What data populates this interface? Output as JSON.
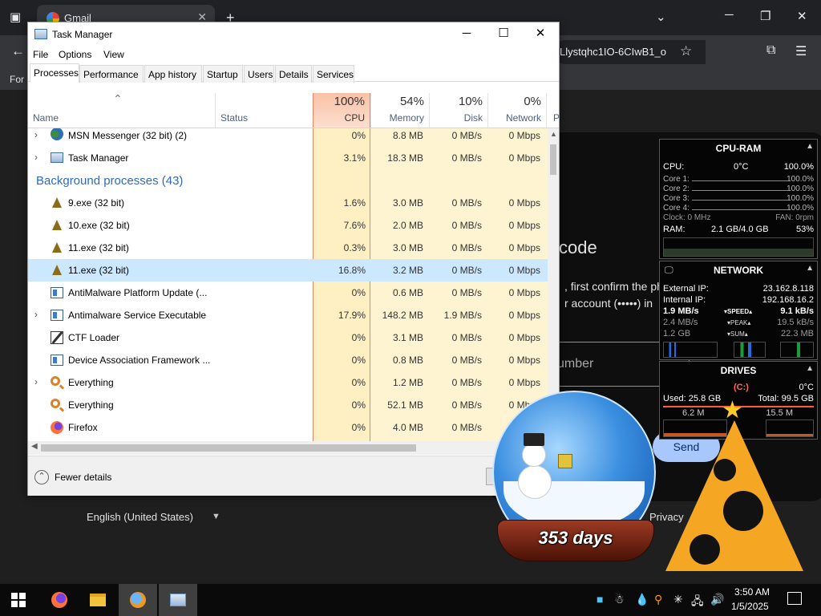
{
  "browser": {
    "tab_title": "Gmail",
    "omnibox_text": "Llystqhc1IO-6CIwB1_o",
    "bookmark_text": "For",
    "page": {
      "heading_fragment": "code",
      "line1": ", first confirm the ph",
      "line2": "r account (•••••) in",
      "field_placeholder": "umber",
      "send_label": "Send",
      "privacy": "Privacy",
      "terms_fragment": "ms",
      "language": "English (United States)"
    }
  },
  "taskmgr": {
    "title": "Task Manager",
    "menu": [
      "File",
      "Options",
      "View"
    ],
    "tabs": [
      "Processes",
      "Performance",
      "App history",
      "Startup",
      "Users",
      "Details",
      "Services"
    ],
    "columns": {
      "name": "Name",
      "status": "Status",
      "cpu": {
        "pct": "100%",
        "label": "CPU"
      },
      "memory": {
        "pct": "54%",
        "label": "Memory"
      },
      "disk": {
        "pct": "10%",
        "label": "Disk"
      },
      "network": {
        "pct": "0%",
        "label": "Network"
      },
      "power": "P"
    },
    "rows": [
      {
        "name": "MSN Messenger (32 bit) (2)",
        "cpu": "0%",
        "mem": "8.8 MB",
        "disk": "0 MB/s",
        "net": "0 Mbps",
        "icon": "msn-icon",
        "expand": true
      },
      {
        "name": "Task Manager",
        "cpu": "3.1%",
        "mem": "18.3 MB",
        "disk": "0 MB/s",
        "net": "0 Mbps",
        "icon": "task-manager-icon",
        "expand": true
      },
      {
        "group": "Background processes (43)"
      },
      {
        "name": "9.exe (32 bit)",
        "cpu": "1.6%",
        "mem": "3.0 MB",
        "disk": "0 MB/s",
        "net": "0 Mbps",
        "icon": "tree-icon"
      },
      {
        "name": "10.exe (32 bit)",
        "cpu": "7.6%",
        "mem": "2.0 MB",
        "disk": "0 MB/s",
        "net": "0 Mbps",
        "icon": "tree-icon"
      },
      {
        "name": "11.exe (32 bit)",
        "cpu": "0.3%",
        "mem": "3.0 MB",
        "disk": "0 MB/s",
        "net": "0 Mbps",
        "icon": "tree-icon"
      },
      {
        "name": "11.exe (32 bit)",
        "cpu": "16.8%",
        "mem": "3.2 MB",
        "disk": "0 MB/s",
        "net": "0 Mbps",
        "icon": "tree-icon",
        "selected": true
      },
      {
        "name": "AntiMalware Platform Update (...",
        "cpu": "0%",
        "mem": "0.6 MB",
        "disk": "0 MB/s",
        "net": "0 Mbps",
        "icon": "app-window-icon"
      },
      {
        "name": "Antimalware Service Executable",
        "cpu": "17.9%",
        "mem": "148.2 MB",
        "disk": "1.9 MB/s",
        "net": "0 Mbps",
        "icon": "app-window-icon",
        "expand": true
      },
      {
        "name": "CTF Loader",
        "cpu": "0%",
        "mem": "3.1 MB",
        "disk": "0 MB/s",
        "net": "0 Mbps",
        "icon": "pen-icon"
      },
      {
        "name": "Device Association Framework ...",
        "cpu": "0%",
        "mem": "0.8 MB",
        "disk": "0 MB/s",
        "net": "0 Mbps",
        "icon": "app-window-icon"
      },
      {
        "name": "Everything",
        "cpu": "0%",
        "mem": "1.2 MB",
        "disk": "0 MB/s",
        "net": "0 Mbps",
        "icon": "magnifier-icon",
        "expand": true
      },
      {
        "name": "Everything",
        "cpu": "0%",
        "mem": "52.1 MB",
        "disk": "0 MB/s",
        "net": "0 Mbps",
        "icon": "magnifier-icon"
      },
      {
        "name": "Firefox",
        "cpu": "0%",
        "mem": "4.0 MB",
        "disk": "0 MB/s",
        "net": "0 Mbps",
        "icon": "firefox-icon"
      }
    ],
    "fewer_details": "Fewer details"
  },
  "gadgets": {
    "cpu_ram": {
      "title": "CPU-RAM",
      "cpu_label": "CPU:",
      "temp": "0°C",
      "cpu_pct": "100.0%",
      "cores": [
        {
          "label": "Core 1:",
          "value": "100.0%"
        },
        {
          "label": "Core 2:",
          "value": "100.0%"
        },
        {
          "label": "Core 3:",
          "value": "100.0%"
        },
        {
          "label": "Core 4:",
          "value": "100.0%"
        }
      ],
      "clock": "Clock: 0 MHz",
      "fan": "FAN: 0rpm",
      "ram_label": "RAM:",
      "ram_used": "2.1 GB/4.0 GB",
      "ram_pct": "53%"
    },
    "network": {
      "title": "NETWORK",
      "ext_label": "External IP:",
      "ext_ip": "23.162.8.118",
      "int_label": "Internal IP:",
      "int_ip": "192.168.16.2",
      "speed_l": "1.9 MB/s",
      "speed_m": "▾SPEED▴",
      "speed_r": "9.1 kB/s",
      "peak_l": "2.4 MB/s",
      "peak_m": "▾PEAK▴",
      "peak_r": "19.5 kB/s",
      "sum_l": "1.2 GB",
      "sum_m": "▾SUM▴",
      "sum_r": "22.3 MB"
    },
    "drives": {
      "title": "DRIVES",
      "drive": "(C:)",
      "temp": "0°C",
      "used": "Used: 25.8 GB",
      "total": "Total: 99.5 GB",
      "read": "6.2 M",
      "write": "15.5 M"
    }
  },
  "globe": {
    "days": "353 days"
  },
  "taskbar": {
    "time": "3:50 AM",
    "date": "1/5/2025"
  }
}
